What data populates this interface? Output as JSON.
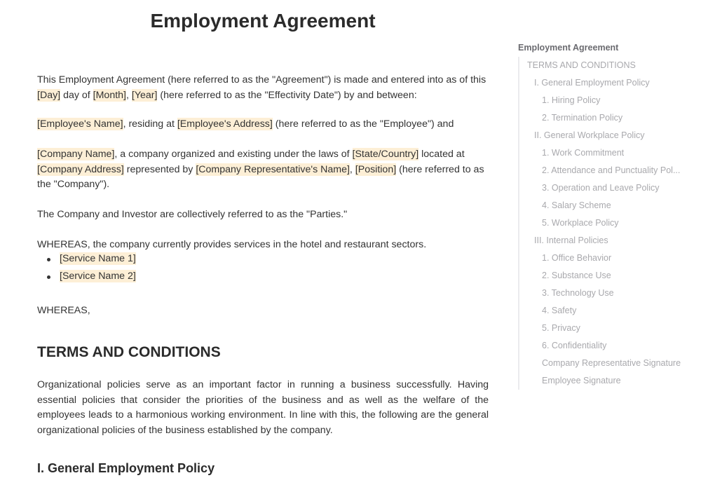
{
  "document": {
    "title": "Employment Agreement",
    "intro": {
      "p1": {
        "t1": "This Employment Agreement (here referred to as the \"Agreement\") is made and entered into as of this ",
        "day": "[Day]",
        "t2": " day of ",
        "month": "[Month]",
        "t3": ", ",
        "year": "[Year]",
        "t4": " (here referred to as the \"Effectivity Date\") by and between:"
      },
      "p2": {
        "employee_name": "[Employee's Name]",
        "t1": ", residing at ",
        "employee_address": "[Employee's Address]",
        "t2": " (here referred to as the \"Employee\") and"
      },
      "p3": {
        "company_name": "[Company Name]",
        "t1": ", a company organized and existing under the laws of ",
        "state_country": "[State/Country]",
        "t2": " located at ",
        "company_address": "[Company Address]",
        "t3": " represented by ",
        "rep_name": "[Company Representative's Name]",
        "t4": ", ",
        "position": "[Position]",
        "t5": " (here referred to as the \"Company\")."
      },
      "p4": "The Company and Investor are collectively referred to as the \"Parties.\"",
      "p5": "WHEREAS, the company currently provides services in the hotel and restaurant sectors.",
      "services": [
        "[Service Name 1]",
        "[Service Name 2]"
      ],
      "p6": "WHEREAS,"
    },
    "terms_heading": "TERMS AND CONDITIONS",
    "terms_paragraph": "Organizational policies serve as an important factor in running a business successfully. Having essential policies that consider the priorities of the business and as well as the welfare of the employees leads to a harmonious working environment. In line with this, the following are the general organizational policies of the business established by the company.",
    "section1_heading": "I. General Employment Policy"
  },
  "colors": {
    "placeholder_highlight": "#fdefd6",
    "body_text": "#333333",
    "toc_text": "#a9a9ad",
    "toc_title": "#6b6b70"
  },
  "toc": {
    "title": "Employment Agreement",
    "items": [
      {
        "label": "TERMS AND CONDITIONS",
        "level": 1
      },
      {
        "label": "I. General Employment Policy",
        "level": 2
      },
      {
        "label": "1. Hiring Policy",
        "level": 3
      },
      {
        "label": "2. Termination Policy",
        "level": 3
      },
      {
        "label": "II. General Workplace Policy",
        "level": 2
      },
      {
        "label": "1. Work Commitment",
        "level": 3
      },
      {
        "label": "2. Attendance and Punctuality Pol...",
        "level": 3
      },
      {
        "label": "3.  Operation and Leave Policy",
        "level": 3
      },
      {
        "label": "4. Salary Scheme",
        "level": 3
      },
      {
        "label": "5.  Workplace Policy",
        "level": 3
      },
      {
        "label": "III. Internal Policies",
        "level": 2
      },
      {
        "label": "1. Office Behavior",
        "level": 3
      },
      {
        "label": "2. Substance Use",
        "level": 3
      },
      {
        "label": "3. Technology Use",
        "level": 3
      },
      {
        "label": "4. Safety",
        "level": 3
      },
      {
        "label": "5. Privacy",
        "level": 3
      },
      {
        "label": "6. Confidentiality",
        "level": 3
      },
      {
        "label": "Company Representative Signature",
        "level": 3
      },
      {
        "label": "Employee Signature",
        "level": 3
      }
    ]
  }
}
